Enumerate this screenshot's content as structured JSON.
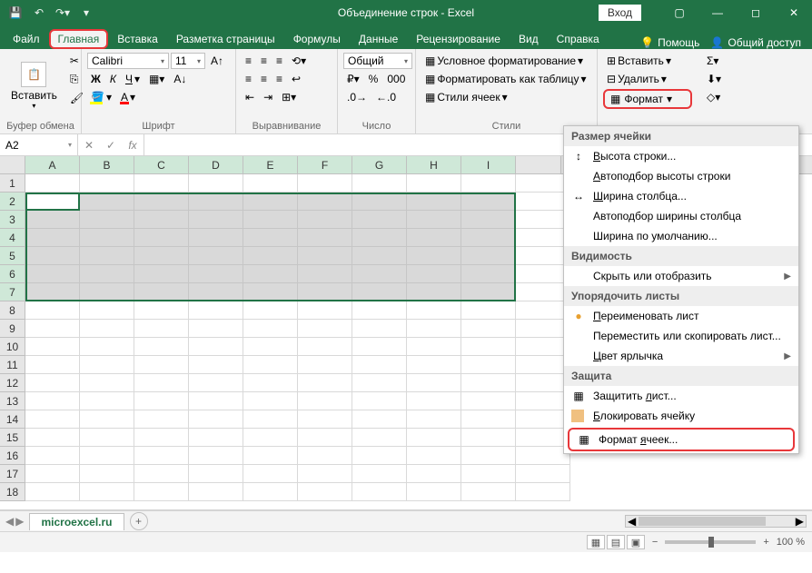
{
  "titlebar": {
    "title": "Объединение строк  -  Excel",
    "login": "Вход"
  },
  "tabs": {
    "file": "Файл",
    "home": "Главная",
    "insert": "Вставка",
    "layout": "Разметка страницы",
    "formulas": "Формулы",
    "data": "Данные",
    "review": "Рецензирование",
    "view": "Вид",
    "help": "Справка",
    "assist": "Помощь",
    "share": "Общий доступ"
  },
  "ribbon": {
    "clipboard": {
      "label": "Буфер обмена",
      "paste": "Вставить"
    },
    "font": {
      "label": "Шрифт",
      "name": "Calibri",
      "size": "11",
      "bold": "Ж",
      "italic": "К",
      "underline": "Ч"
    },
    "align": {
      "label": "Выравнивание"
    },
    "number": {
      "label": "Число",
      "format": "Общий"
    },
    "styles": {
      "label": "Стили",
      "cond": "Условное форматирование",
      "table": "Форматировать как таблицу",
      "cell": "Стили ячеек"
    },
    "cells": {
      "insert": "Вставить",
      "delete": "Удалить",
      "format": "Формат"
    }
  },
  "namebox": "A2",
  "columns": [
    "A",
    "B",
    "C",
    "D",
    "E",
    "F",
    "G",
    "H",
    "I"
  ],
  "rows_count": 18,
  "dropdown": {
    "size_header": "Размер ячейки",
    "row_height": "Высота строки...",
    "autofit_row": "Автоподбор высоты строки",
    "col_width": "Ширина столбца...",
    "autofit_col": "Автоподбор ширины столбца",
    "default_width": "Ширина по умолчанию...",
    "visibility_header": "Видимость",
    "hide": "Скрыть или отобразить",
    "organize_header": "Упорядочить листы",
    "rename": "Переименовать лист",
    "move": "Переместить или скопировать лист...",
    "tab_color": "Цвет ярлычка",
    "protect_header": "Защита",
    "protect_sheet": "Защитить лист...",
    "lock_cell": "Блокировать ячейку",
    "format_cells": "Формат ячеек..."
  },
  "sheet": {
    "name": "microexcel.ru"
  },
  "status": {
    "zoom": "100 %"
  }
}
